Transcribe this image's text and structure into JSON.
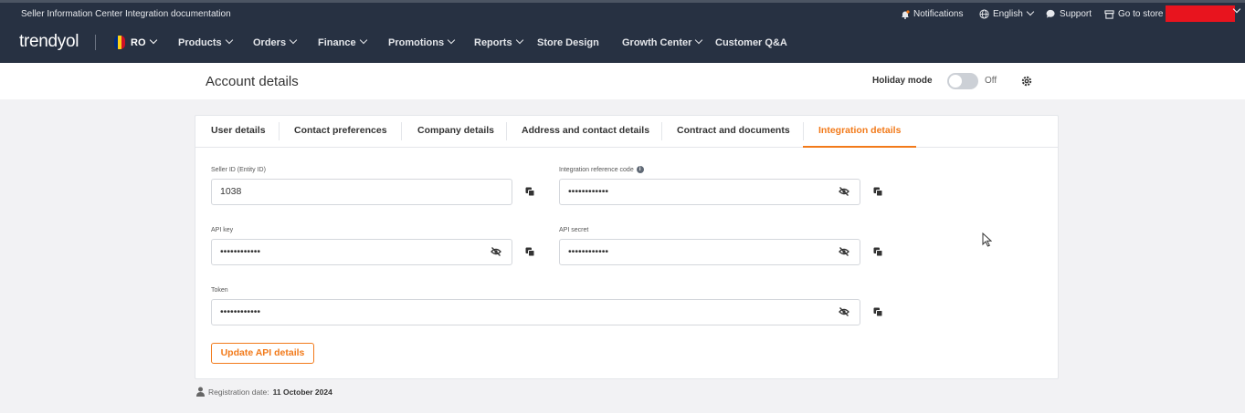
{
  "topbar": {
    "seller_info": "Seller Information Center",
    "integration_docs": "Integration documentation",
    "notifications": "Notifications",
    "language": "English",
    "support": "Support",
    "go_to_store": "Go to store"
  },
  "nav": {
    "logo": "trendyol",
    "region": "RO",
    "items": [
      "Products",
      "Orders",
      "Finance",
      "Promotions",
      "Reports",
      "Store Design",
      "Growth Center",
      "Customer Q&A"
    ]
  },
  "header": {
    "title": "Account details",
    "holiday_label": "Holiday mode",
    "holiday_state": "Off"
  },
  "tabs": [
    "User details",
    "Contact preferences",
    "Company details",
    "Address and contact details",
    "Contract and documents",
    "Integration details"
  ],
  "active_tab": "Integration details",
  "fields": {
    "seller_id": {
      "label": "Seller ID (Entity ID)",
      "value": "1038"
    },
    "integration_ref": {
      "label": "Integration reference code",
      "value": "••••••••••••"
    },
    "api_key": {
      "label": "API key",
      "value": "••••••••••••"
    },
    "api_secret": {
      "label": "API secret",
      "value": "••••••••••••"
    },
    "token": {
      "label": "Token",
      "value": "••••••••••••"
    }
  },
  "update_button": "Update API details",
  "registration": {
    "label": "Registration date:",
    "date": "11 October 2024"
  },
  "colors": {
    "accent": "#f27a1a",
    "nav_bg": "#273142",
    "flag": [
      "#002b7f",
      "#fcd116",
      "#ce1126"
    ]
  }
}
